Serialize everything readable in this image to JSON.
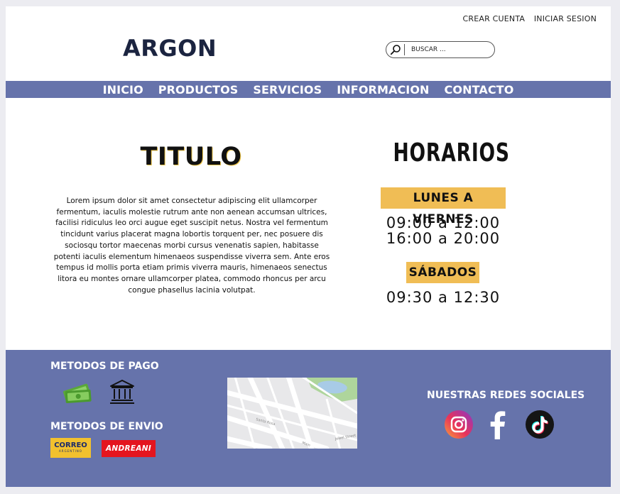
{
  "header": {
    "links": [
      "CREAR CUENTA",
      "INICIAR SESION"
    ],
    "logo": "ARGON",
    "search": {
      "placeholder": "BUSCAR ..."
    }
  },
  "nav": [
    "INICIO",
    "PRODUCTOS",
    "SERVICIOS",
    "INFORMACION",
    "CONTACTO"
  ],
  "main": {
    "title": "TITULO",
    "body": "Lorem ipsum dolor sit amet consectetur adipiscing elit ullamcorper fermentum, iaculis molestie rutrum ante non aenean accumsan ultrices, facilisi ridiculus leo orci augue eget suscipit netus. Nostra vel fermentum tincidunt varius placerat magna lobortis torquent per, nec posuere dis sociosqu tortor maecenas morbi cursus venenatis sapien, habitasse potenti iaculis elementum himenaeos suspendisse viverra sem. Ante eros tempus id mollis porta etiam primis viverra mauris, himenaeos senectus litora eu montes ornare ullamcorper platea, commodo rhoncus per arcu congue phasellus lacinia volutpat."
  },
  "schedule": {
    "heading": "HORARIOS",
    "weekdays_label": "LUNES A VIERNES",
    "weekdays_hours": [
      "09:00 a 12:00",
      "16:00 a 20:00"
    ],
    "saturday_label": "SÁBADOS",
    "saturday_hours": "09:30 a 12:30"
  },
  "footer": {
    "payment_heading": "METODOS DE PAGO",
    "payment_icons": [
      "cash-icon",
      "bank-icon"
    ],
    "shipping_heading": "METODOS DE ENVIO",
    "shipping": {
      "correo": "CORREO",
      "correo_sub": "ARGENTINO",
      "andreani": "ANDREANI"
    },
    "social_heading": "NUESTRAS REDES SOCIALES",
    "social_icons": [
      "instagram-icon",
      "facebook-icon",
      "tiktok-icon"
    ],
    "map_streets": [
      "Santa Rosa",
      "Jewel Street",
      "Main"
    ]
  },
  "colors": {
    "nav_bg": "#6673ab",
    "badge": "#f0bd55",
    "logo": "#1b2440"
  }
}
